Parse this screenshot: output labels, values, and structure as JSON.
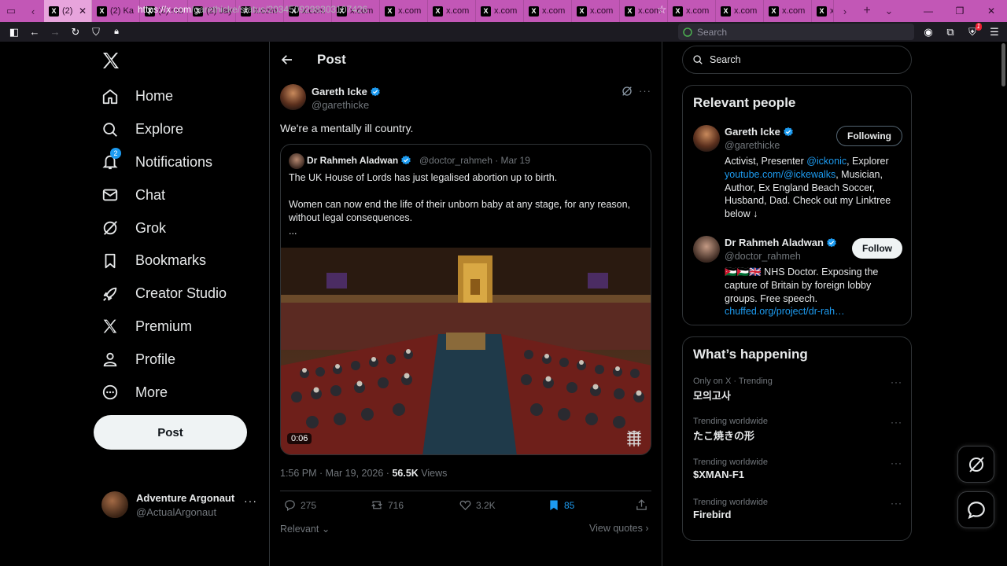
{
  "browser": {
    "tabs": [
      {
        "label": "(2)",
        "active": true
      },
      {
        "label": "(2) Ka"
      },
      {
        "label": "(2) ma"
      },
      {
        "label": "(2) Jay"
      },
      {
        "label": "x.com"
      },
      {
        "label": "x.com"
      },
      {
        "label": "x.com"
      },
      {
        "label": "x.com"
      },
      {
        "label": "x.com"
      },
      {
        "label": "x.com"
      },
      {
        "label": "x.com"
      },
      {
        "label": "x.com"
      },
      {
        "label": "x.com"
      },
      {
        "label": "x.com"
      },
      {
        "label": "x.com"
      },
      {
        "label": "x.com"
      },
      {
        "label": "x."
      }
    ],
    "url_host": "https://x.com",
    "url_path": "/garethicke/status/2034509298303107426",
    "search_placeholder": "Search",
    "extension_badge": "1",
    "tab_favicon": "X"
  },
  "nav": {
    "items": [
      {
        "label": "Home",
        "icon": "home-icon"
      },
      {
        "label": "Explore",
        "icon": "search-icon"
      },
      {
        "label": "Notifications",
        "icon": "bell-icon",
        "badge": "2"
      },
      {
        "label": "Chat",
        "icon": "mail-icon"
      },
      {
        "label": "Grok",
        "icon": "grok-icon"
      },
      {
        "label": "Bookmarks",
        "icon": "bookmark-icon"
      },
      {
        "label": "Creator Studio",
        "icon": "rocket-icon"
      },
      {
        "label": "Premium",
        "icon": "x-icon"
      },
      {
        "label": "Profile",
        "icon": "person-icon"
      },
      {
        "label": "More",
        "icon": "more-circle-icon"
      }
    ],
    "post_button": "Post",
    "account": {
      "name": "Adventure Argonaut",
      "handle": "@ActualArgonaut"
    }
  },
  "post": {
    "header_title": "Post",
    "author_name": "Gareth Icke",
    "author_handle": "@garethicke",
    "text": "We're a mentally ill country.",
    "quote": {
      "name": "Dr Rahmeh Aladwan",
      "meta": "@doctor_rahmeh · Mar 19",
      "lines": [
        "The UK House of Lords has just legalised abortion up to birth.",
        "",
        "Women can now end the life of their unborn baby at any stage, for any reason, without legal consequences.",
        "..."
      ],
      "video_time": "0:06"
    },
    "timestamp": "1:56 PM · Mar 19, 2026 · ",
    "views_count": "56.5K",
    "views_label": " Views",
    "actions": {
      "replies": "275",
      "reposts": "716",
      "likes": "3.2K",
      "bookmarks": "85"
    },
    "sort_label": "Relevant",
    "view_quotes": "View quotes"
  },
  "right": {
    "search_placeholder": "Search",
    "relevant_title": "Relevant people",
    "people": [
      {
        "name": "Gareth Icke",
        "handle": "@garethicke",
        "button": "Following",
        "bio_parts": [
          "Activist, Presenter ",
          "@ickonic",
          ", Explorer ",
          "youtube.com/@ickewalks",
          ", Musician, Author, Ex England Beach Soccer, Husband, Dad. Check out my Linktree below ↓"
        ]
      },
      {
        "name": "Dr Rahmeh Aladwan",
        "handle": "@doctor_rahmeh",
        "button": "Follow",
        "bio_parts": [
          "🇯🇴🇵🇸🇬🇧 NHS Doctor. Exposing the capture of Britain by foreign lobby groups. Free speech. ",
          "chuffed.org/project/dr-rah…"
        ]
      }
    ],
    "happening_title": "What’s happening",
    "trends": [
      {
        "context": "Only on X · Trending",
        "title": "모의고사"
      },
      {
        "context": "Trending worldwide",
        "title": "たこ焼きの形"
      },
      {
        "context": "Trending worldwide",
        "title": "$XMAN-F1"
      },
      {
        "context": "Trending worldwide",
        "title": "Firebird"
      }
    ]
  },
  "colors": {
    "accent": "#1d9bf0",
    "tabbar": "#c257b6",
    "background": "#000000",
    "border": "#2f3336"
  }
}
